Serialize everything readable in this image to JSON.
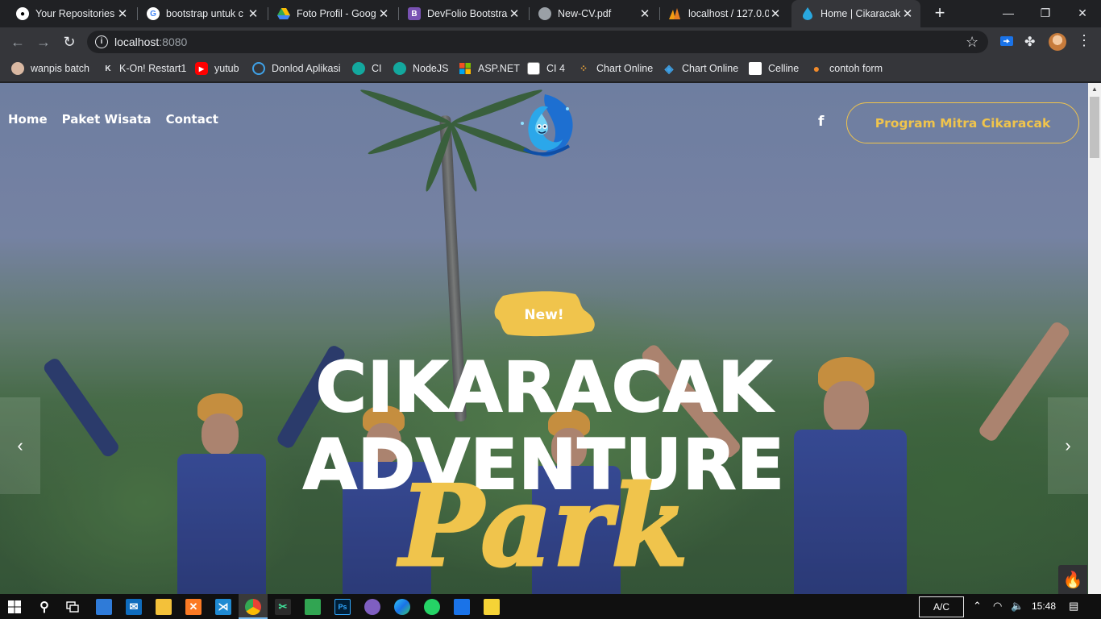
{
  "browser": {
    "tabs": [
      {
        "title": "Your Repositories",
        "icon": "github-icon"
      },
      {
        "title": "bootstrap untuk c",
        "icon": "google-icon"
      },
      {
        "title": "Foto Profil - Goog",
        "icon": "google-drive-icon"
      },
      {
        "title": "DevFolio Bootstrap",
        "icon": "bootstrap-icon",
        "icon_text": "B"
      },
      {
        "title": "New-CV.pdf",
        "icon": "globe-icon"
      },
      {
        "title": "localhost / 127.0.0",
        "icon": "phpmyadmin-icon"
      },
      {
        "title": "Home | Cikaracak ",
        "icon": "cikaracak-icon",
        "active": true
      }
    ],
    "new_tab_label": "+",
    "window_controls": {
      "minimize": "—",
      "maximize": "❐",
      "close": "✕"
    },
    "url_host": "localhost",
    "url_port": ":8080",
    "info_icon": "i",
    "bookmarks": [
      {
        "label": "wanpis batch",
        "icon": "anime-avatar-icon"
      },
      {
        "label": "K-On! Restart1",
        "icon": "k-on-icon",
        "icon_text": "K"
      },
      {
        "label": "yutub",
        "icon": "youtube-icon"
      },
      {
        "label": "Donlod Aplikasi",
        "icon": "edge-icon"
      },
      {
        "label": "CI",
        "icon": "ci-icon"
      },
      {
        "label": "NodeJS",
        "icon": "nodejs-icon"
      },
      {
        "label": "ASP.NET",
        "icon": "microsoft-icon"
      },
      {
        "label": "CI 4",
        "icon": "ci4-icon"
      },
      {
        "label": "Chart Online",
        "icon": "chart-online-icon"
      },
      {
        "label": "Chart Online",
        "icon": "chart-online-diamond-icon"
      },
      {
        "label": "Celline",
        "icon": "celline-icon"
      },
      {
        "label": "contoh form",
        "icon": "location-pin-icon"
      }
    ]
  },
  "site": {
    "nav": [
      "Home",
      "Paket Wisata",
      "Contact"
    ],
    "facebook_label": "f",
    "mitra_button": "Program Mitra Cikaracak",
    "badge": "New!",
    "title_line1": "CIKARACAK",
    "title_line2": "ADVENTURE",
    "title_script": "Park",
    "arrow_prev": "‹",
    "arrow_next": "›",
    "fire_icon": "🔥"
  },
  "taskbar": {
    "ac_label": "A/C",
    "time": "15:48"
  },
  "colors": {
    "accent_yellow": "#f0c44c",
    "chrome_dark": "#202124",
    "chrome_toolbar": "#35363a"
  }
}
